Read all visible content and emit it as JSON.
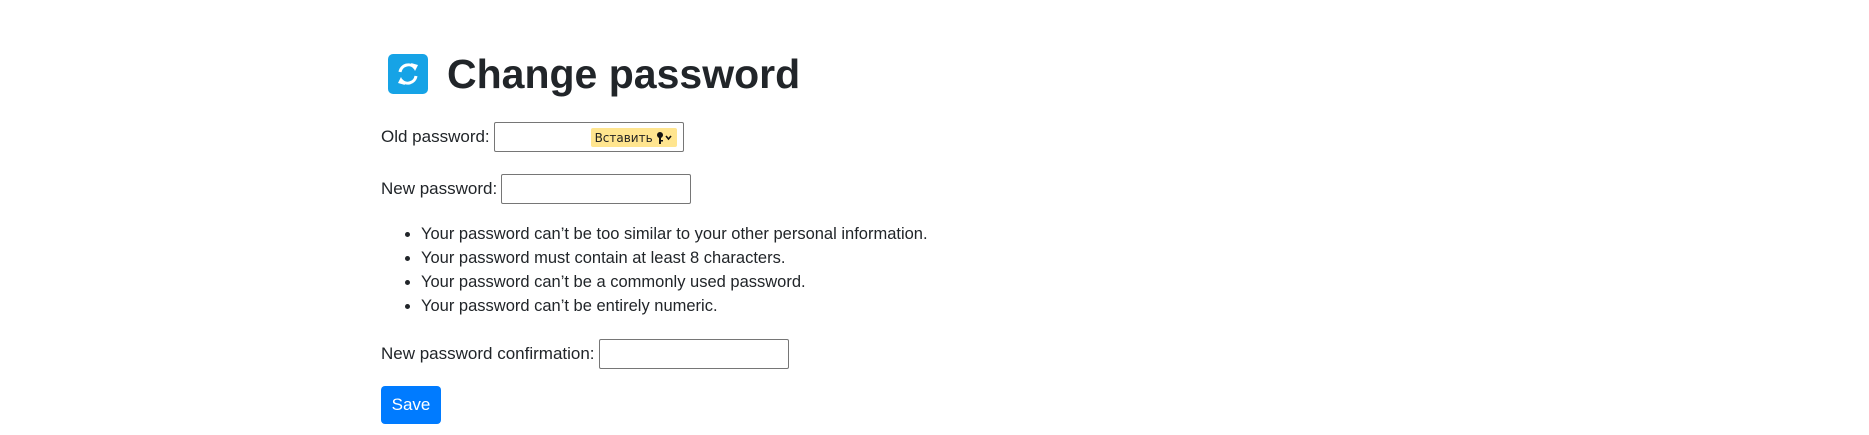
{
  "page": {
    "title": "Change password",
    "icon": "sync-icon",
    "accent_color": "#16a3e6"
  },
  "form": {
    "old_password": {
      "label": "Old password:",
      "value": "",
      "paste_helper": {
        "label": "Вставить",
        "icon": "key-icon",
        "background": "#ffe58f"
      }
    },
    "new_password": {
      "label": "New password:",
      "value": ""
    },
    "help_text": [
      "Your password can’t be too similar to your other personal information.",
      "Your password must contain at least 8 characters.",
      "Your password can’t be a commonly used password.",
      "Your password can’t be entirely numeric."
    ],
    "new_password_confirmation": {
      "label": "New password confirmation:",
      "value": ""
    },
    "save_label": "Save",
    "save_color": "#007bff"
  }
}
